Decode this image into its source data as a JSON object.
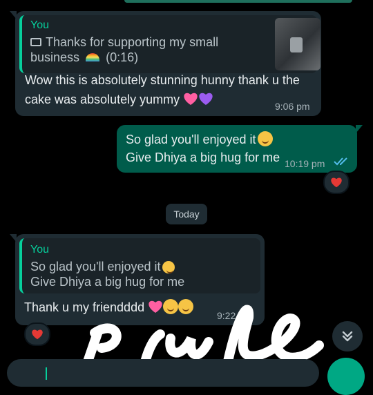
{
  "messages": {
    "first": {
      "quote_sender": "You",
      "quote_line1": "Thanks for supporting my small",
      "quote_line2": "business",
      "quote_duration": "(0:16)",
      "text_line1": "Wow this is absolutely stunning hunny thank u the",
      "text_line2": "cake was absolutely yummy",
      "time": "9:06 pm"
    },
    "second": {
      "line1": "So glad you'll enjoyed it",
      "line2": "Give Dhiya a big hug for me",
      "time": "10:19 pm",
      "status": "read"
    },
    "date_separator": "Today",
    "third": {
      "quote_sender": "You",
      "quote_line1": "So glad you'll enjoyed it",
      "quote_line2": "Give Dhiya a big hug for me",
      "text": "Thank u my friendddd",
      "time": "9:22 am"
    }
  },
  "colors": {
    "accent": "#06cf9c",
    "read_ticks": "#53bdeb",
    "heart": "#e53935",
    "outgoing_bubble": "#005c4b",
    "incoming_bubble": "#1f2c33"
  },
  "icons": {
    "video": "video-icon",
    "rainbow": "rainbow-icon",
    "double_check": "double-check-icon",
    "scroll_down": "chevron-double-down-icon"
  }
}
